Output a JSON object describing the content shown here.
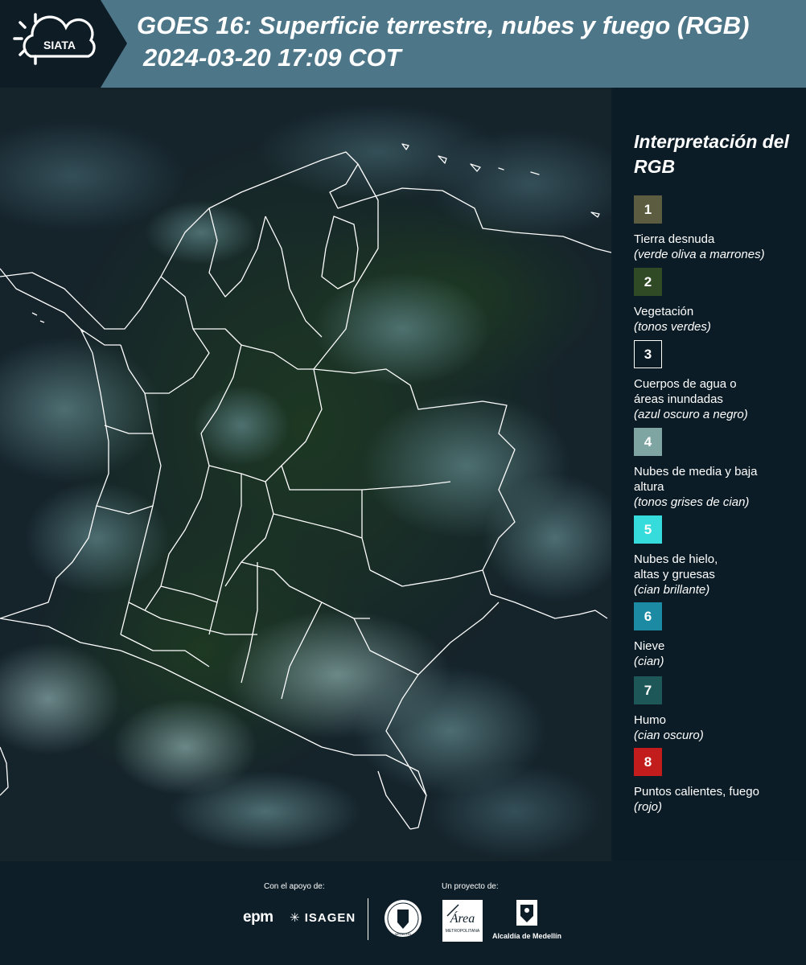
{
  "header": {
    "logo_text": "SIATA",
    "title_line1": "GOES 16: Superficie terrestre, nubes y fuego (RGB)",
    "title_line2": "2024-03-20 17:09 COT"
  },
  "legend": {
    "title": "Interpretación del RGB",
    "items": [
      {
        "number": "1",
        "label": "Tierra desnuda",
        "sub": "(verde oliva a marrones)",
        "color": "#5c5c40"
      },
      {
        "number": "2",
        "label": "Vegetación",
        "sub": "(tonos verdes)",
        "color": "#2f4a24"
      },
      {
        "number": "3",
        "label": "Cuerpos de agua o áreas inundadas",
        "sub": "(azul oscuro a negro)",
        "color": "#0b1c26"
      },
      {
        "number": "4",
        "label": "Nubes de media y baja altura",
        "sub": "(tonos grises de cian)",
        "color": "#7fa5a3"
      },
      {
        "number": "5",
        "label": "Nubes de hielo, altas y gruesas",
        "sub": "(cian brillante)",
        "color": "#36dcdc"
      },
      {
        "number": "6",
        "label": "Nieve",
        "sub": "(cian)",
        "color": "#1d8aa4"
      },
      {
        "number": "7",
        "label": "Humo",
        "sub": "(cian oscuro)",
        "color": "#1e5757"
      },
      {
        "number": "8",
        "label": "Puntos calientes, fuego",
        "sub": "(rojo)",
        "color": "#c31c1c"
      }
    ]
  },
  "footer": {
    "support_label": "Con el apoyo de:",
    "project_label": "Un proyecto de:",
    "sponsor_epm": "epm",
    "sponsor_isagen": "ISAGEN",
    "seal_text": "MEDELLÍN",
    "area_text": "METROPOLITANA",
    "alcaldia_text": "Alcaldía de Medellín"
  }
}
